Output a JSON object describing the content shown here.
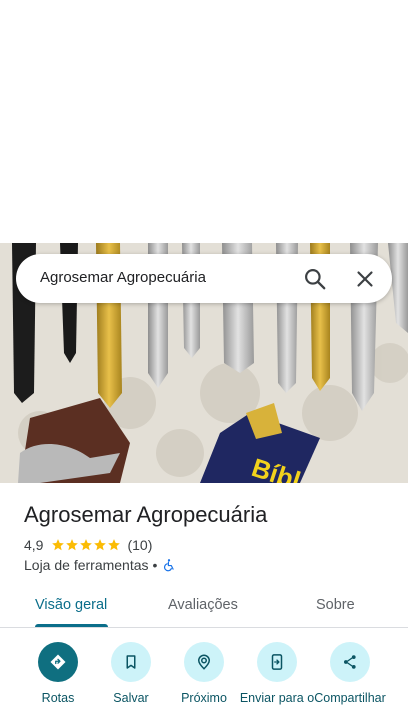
{
  "search": {
    "query": "Agrosemar Agropecuária"
  },
  "place": {
    "name": "Agrosemar Agropecuária",
    "rating": "4,9",
    "rating_value": 4.9,
    "review_count": "(10)",
    "category": "Loja de ferramentas",
    "separator": "•"
  },
  "tabs": [
    {
      "label": "Visão geral",
      "active": true
    },
    {
      "label": "Avaliações",
      "active": false
    },
    {
      "label": "Sobre",
      "active": false
    }
  ],
  "actions": [
    {
      "label": "Rotas",
      "icon": "directions-icon"
    },
    {
      "label": "Salvar",
      "icon": "bookmark-icon"
    },
    {
      "label": "Próximo",
      "icon": "nearby-icon"
    },
    {
      "label": "Enviar para o",
      "icon": "send-to-phone-icon"
    },
    {
      "label": "Compartilhar",
      "icon": "share-icon"
    }
  ],
  "colors": {
    "accent": "#0b6e8a",
    "star": "#fbbc04",
    "action_bg": "#cdf3f9",
    "action_primary": "#0f6f80"
  }
}
